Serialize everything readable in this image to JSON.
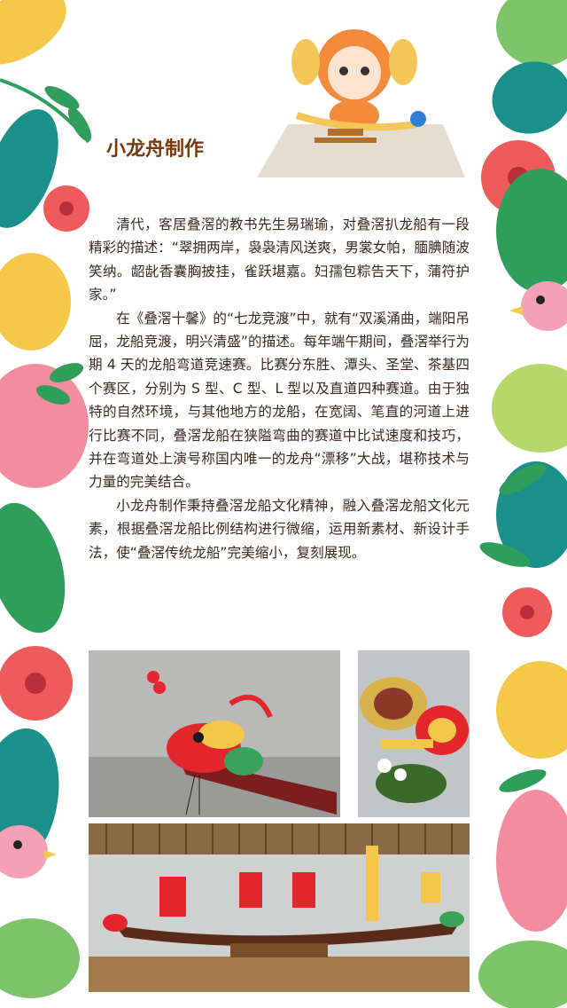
{
  "section_title": "小龙舟制作",
  "paragraphs": [
    "清代，客居叠滘的教书先生易瑞瑜，对叠滘扒龙船有一段精彩的描述：“翠拥两岸，袅袅清风送爽，男裳女帕，腼腆随波笑纳。龆龀香囊胸披挂，雀跃堪嘉。妇孺包粽告天下，蒲符护家。”",
    "在《叠滘十馨》的“七龙竞渡”中，就有“双溪涌曲，端阳吊屈，龙船竞渡，明兴清盛”的描述。每年端午期间，叠滘举行为期 4 天的龙船弯道竞速赛。比赛分东胜、潭头、圣堂、茶基四个赛区，分别为 S 型、C 型、L 型以及直道四种赛道。由于独特的自然环境，与其他地方的龙船，在宽阔、笔直的河道上进行比赛不同，叠滘龙船在狭隘弯曲的赛道中比试速度和技巧，并在弯道处上演号称国内唯一的龙舟“漂移”大战，堪称技术与力量的完美结合。",
    "小龙舟制作秉持叠滘龙船文化精神，融入叠滘龙船文化元素，根据叠滘龙船比例结构进行微缩，运用新素材、新设计手法，使“叠滘传统龙船”完美缩小，复刻展现。"
  ],
  "colors": {
    "title": "#7a3a10",
    "text": "#3a2a20",
    "leaf_green": "#2e9e5a",
    "leaf_teal": "#1b8f8a",
    "leaf_yellow": "#f6c84a",
    "flower_red": "#ef5b5b",
    "flower_pink": "#f48ca0",
    "bird_pink": "#f6a0b8"
  },
  "icons": [
    "mascot-fish-kid-icon",
    "dragon-boat-model-icon",
    "flower-icon",
    "leaf-icon",
    "bird-icon"
  ],
  "photos": [
    "dragon-head-photo",
    "drums-closeup-photo",
    "dragon-boat-model-photo"
  ]
}
